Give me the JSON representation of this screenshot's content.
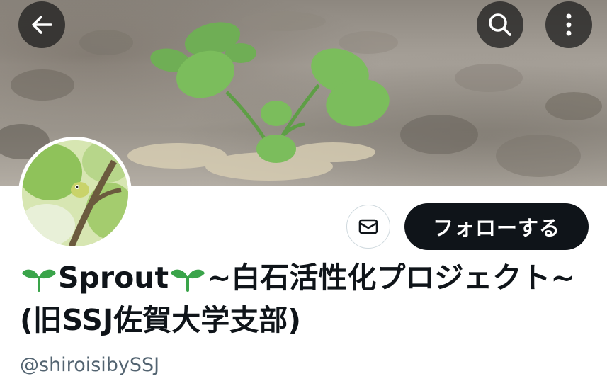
{
  "header": {
    "back_icon": "arrow-left-icon",
    "search_icon": "search-icon",
    "more_icon": "more-vertical-icon"
  },
  "profile": {
    "display_name_part1": "Sprout",
    "display_name_part2": "~白石活性化プロジェクト~(旧SSJ佐賀大学支部)",
    "handle": "@shiroisibySSJ",
    "name_icon": "seedling-icon"
  },
  "actions": {
    "message_icon": "envelope-icon",
    "follow_label": "フォローする"
  },
  "colors": {
    "follow_bg": "#0f1419",
    "text_primary": "#0f1419",
    "text_secondary": "#536471",
    "sprout_green": "#3aa44a"
  }
}
